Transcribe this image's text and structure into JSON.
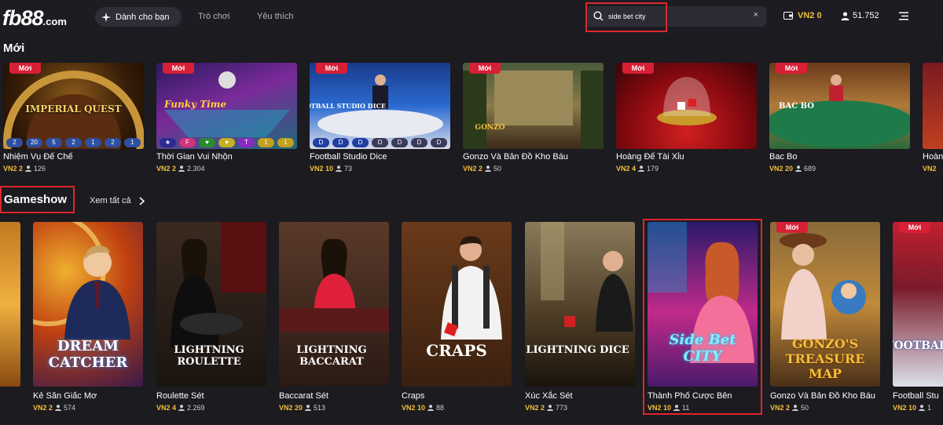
{
  "header": {
    "logo_text": "fb88",
    "logo_suffix": ".com",
    "nav_pill_label": "Dành cho bạn",
    "nav_links": [
      "Trò chơi",
      "Yêu thích"
    ],
    "search_value": "side bet city",
    "search_placeholder": "",
    "clear_symbol": "×",
    "wallet_label": "VN2 0",
    "online_users": "51.752"
  },
  "new_section": {
    "title": "Mới",
    "badge": "Mới",
    "cards": [
      {
        "name": "Nhiệm Vụ Đế Chế",
        "cur": "VN2 2",
        "players": "126",
        "art_title": "IMPERIAL QUEST"
      },
      {
        "name": "Thời Gian Vui Nhộn",
        "cur": "VN2 2",
        "players": "2.304",
        "art_title": "Funky Time"
      },
      {
        "name": "Football Studio Dice",
        "cur": "VN2 10",
        "players": "73",
        "art_title": "FOOTBALL STUDIO DICE"
      },
      {
        "name": "Gonzo Và Bản Đồ Kho Báu",
        "cur": "VN2 2",
        "players": "50",
        "art_title": "GONZO"
      },
      {
        "name": "Hoàng Đế Tài Xỉu",
        "cur": "VN2 4",
        "players": "179",
        "art_title": ""
      },
      {
        "name": "Bac Bo",
        "cur": "VN2 20",
        "players": "689",
        "art_title": "BAC BO"
      },
      {
        "name": "Hoàn",
        "cur": "VN2",
        "players": "",
        "art_title": ""
      }
    ]
  },
  "gameshow_section": {
    "title": "Gameshow",
    "view_all": "Xem tất cả",
    "badge": "Mới",
    "cards": [
      {
        "name": "Kẻ Săn Giấc Mơ",
        "cur": "VN2 2",
        "players": "574",
        "art_title": "DREAM CATCHER"
      },
      {
        "name": "Roulette Sét",
        "cur": "VN2 4",
        "players": "2.269",
        "art_title": "LIGHTNING ROULETTE"
      },
      {
        "name": "Baccarat Sét",
        "cur": "VN2 20",
        "players": "513",
        "art_title": "LIGHTNING BACCARAT"
      },
      {
        "name": "Craps",
        "cur": "VN2 10",
        "players": "88",
        "art_title": "CRAPS"
      },
      {
        "name": "Xúc Xắc Sét",
        "cur": "VN2 2",
        "players": "773",
        "art_title": "LIGHTNING DICE"
      },
      {
        "name": "Thành Phố Cược Bên",
        "cur": "VN2 10",
        "players": "11",
        "art_title": "Side Bet CITY"
      },
      {
        "name": "Gonzo Và Bản Đồ Kho Báu",
        "cur": "VN2 2",
        "players": "50",
        "art_title": "GONZO'S TREASURE MAP"
      },
      {
        "name": "Football Stu",
        "cur": "VN2 10",
        "players": "1",
        "art_title": "FOOTBALL"
      }
    ]
  },
  "colors": {
    "background": "#1b1b20",
    "badge": "#d71f36",
    "accent_gold": "#f2c03a",
    "highlight_box": "#e0262c"
  }
}
